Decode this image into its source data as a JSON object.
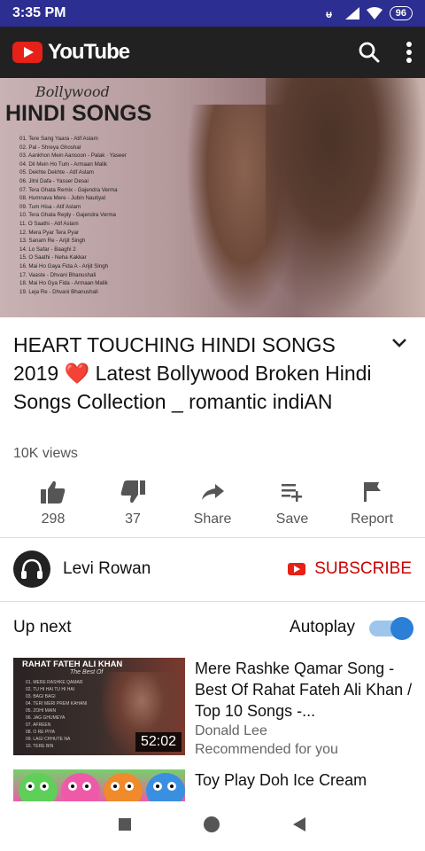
{
  "status_bar": {
    "time": "3:35 PM",
    "battery": "96"
  },
  "app_bar": {
    "logo_text": "YouTube",
    "search_icon": "search-icon",
    "more_icon": "more-vert-icon"
  },
  "video": {
    "brand": "Bollywood",
    "heading": "HINDI SONGS",
    "tracklist": [
      "01. Tere Sang Yaara - Atif Aslam",
      "02. Pal - Shreya Ghoshal",
      "03. Aankhon Mein Aansoon - Palak · Yaseer",
      "04. Dil Mein Ho Tum - Armaan Malik",
      "05. Dekhte Dekhte - Atif Aslam",
      "06. Jitni Dafa - Yasser Desai",
      "07. Tera Ghata Remix - Gajendra Verma",
      "08. Humnava Mere - Jubin Nautiyal",
      "09. Tum Hisa - Atif Aslam",
      "10. Tera Ghata Reply - Gajendra Verma",
      "11. O Saathi - Atif Aslam",
      "12. Mera Pyar Tera Pyar",
      "13. Sanam Re - Arijit Singh",
      "14. Lo Safar - Baaghi 2",
      "15. O Saathi - Neha Kakkar",
      "16. Mai Ho Gaya Fida A - Arijit Singh",
      "17. Vaaste - Dhvani Bhanushali",
      "18. Mai Ho Gya Fida - Armaan Malik",
      "19. Leja Re - Dhvani Bhanushali"
    ]
  },
  "details": {
    "title_part1": "HEART TOUCHING HINDI SONGS 2019",
    "heart": "❤️",
    "title_part2": "Latest Bollywood Broken Hindi Songs Collection _ romantic indiAN",
    "views": "10K views"
  },
  "actions": [
    {
      "label": "298",
      "icon": "thumb-up-icon"
    },
    {
      "label": "37",
      "icon": "thumb-down-icon"
    },
    {
      "label": "Share",
      "icon": "share-icon"
    },
    {
      "label": "Save",
      "icon": "playlist-add-icon"
    },
    {
      "label": "Report",
      "icon": "flag-icon"
    }
  ],
  "channel": {
    "name": "Levi Rowan",
    "subscribe_label": "SUBSCRIBE"
  },
  "up_next": {
    "label": "Up next",
    "autoplay_label": "Autoplay",
    "autoplay_on": true
  },
  "recommendations": [
    {
      "thumb_title": "RAHAT FATEH ALI KHAN",
      "thumb_subtitle": "The Best Of",
      "thumb_list": [
        "01. MERE RASHKE QAMAR",
        "02. TU HI HAI TU HI HAI",
        "03. BAGI BAGI",
        "04. TERI MERI PREM KAHANI",
        "05. ZOHI MAIN",
        "06. JAG GHUMEYA",
        "07. AFREEN",
        "08. O RE PIYA",
        "09. LAGI CHHUTE NA",
        "10. TERE BIN"
      ],
      "duration": "52:02",
      "title": "Mere Rashke Qamar Song - Best Of Rahat Fateh Ali Khan / Top 10 Songs -...",
      "channel": "Donald Lee",
      "meta": "Recommended for you"
    },
    {
      "title": "Toy Play Doh Ice Cream"
    }
  ],
  "colors": {
    "status_bar": "#2c2e91",
    "app_bar": "#212121",
    "youtube_red": "#e62117",
    "subscribe_red": "#cc0000",
    "toggle_blue": "#2b7fd6"
  }
}
